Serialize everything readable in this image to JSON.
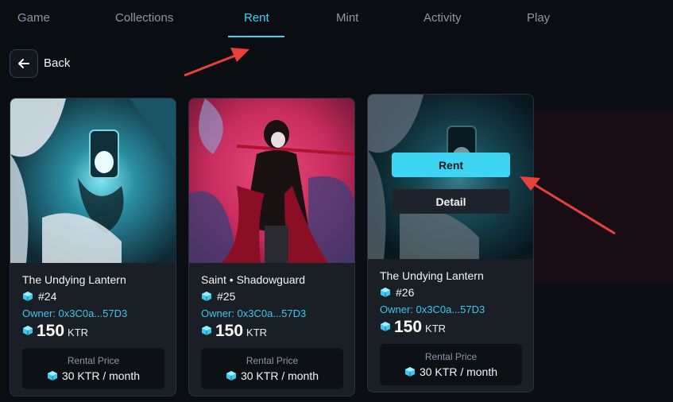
{
  "nav": {
    "tabs": [
      {
        "label": "Game"
      },
      {
        "label": "Collections"
      },
      {
        "label": "Rent"
      },
      {
        "label": "Mint"
      },
      {
        "label": "Activity"
      },
      {
        "label": "Play"
      }
    ],
    "active_tab": "Rent"
  },
  "back": {
    "label": "Back"
  },
  "cards": [
    {
      "title": "The Undying Lantern",
      "token_id": "#24",
      "owner": "Owner: 0x3C0a...57D3",
      "price": "150",
      "price_unit": "KTR",
      "rental_label": "Rental Price",
      "rental_value": "30 KTR / month"
    },
    {
      "title": "Saint • Shadowguard",
      "token_id": "#25",
      "owner": "Owner: 0x3C0a...57D3",
      "price": "150",
      "price_unit": "KTR",
      "rental_label": "Rental Price",
      "rental_value": "30 KTR / month"
    },
    {
      "title": "The Undying Lantern",
      "token_id": "#26",
      "owner": "Owner: 0x3C0a...57D3",
      "price": "150",
      "price_unit": "KTR",
      "rental_label": "Rental Price",
      "rental_value": "30 KTR / month",
      "hover_rent_label": "Rent",
      "hover_detail_label": "Detail"
    }
  ],
  "colors": {
    "accent": "#3ed4f4",
    "background": "#0a0e13",
    "card": "#1a1e25",
    "annotation_arrow": "#e8413a"
  }
}
